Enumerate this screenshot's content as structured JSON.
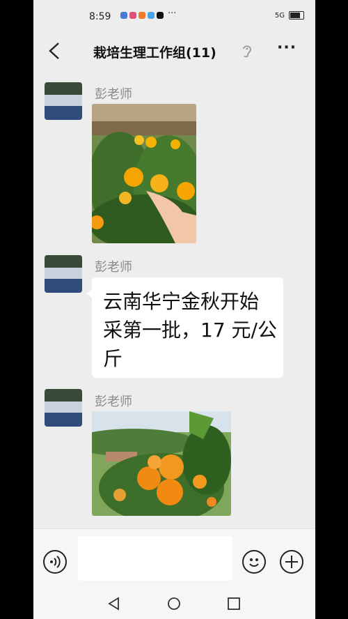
{
  "status_bar": {
    "time": "8:59",
    "more": "···",
    "signal": "5G"
  },
  "header": {
    "title": "栽培生理工作组(11)",
    "more": "···"
  },
  "messages": [
    {
      "sender": "彭老师",
      "type": "image",
      "image_desc": "oranges on tree with hand"
    },
    {
      "sender": "彭老师",
      "type": "text",
      "text": "云南华宁金秋开始采第一批，17 元/公斤"
    },
    {
      "sender": "彭老师",
      "type": "image",
      "image_desc": "oranges on tree"
    }
  ],
  "colors": {
    "background": "#ededed",
    "bubble": "#ffffff",
    "sender": "#8a8a8a"
  }
}
